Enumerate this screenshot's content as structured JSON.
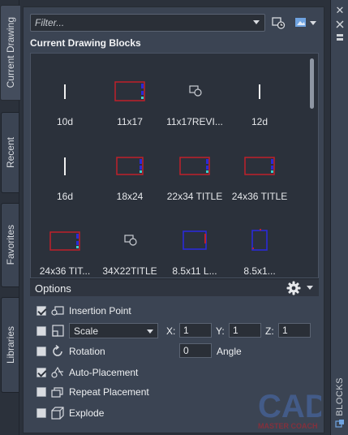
{
  "left_tabs": [
    {
      "label": "Current Drawing",
      "active": true
    },
    {
      "label": "Recent",
      "active": false
    },
    {
      "label": "Favorites",
      "active": false
    },
    {
      "label": "Libraries",
      "active": false
    }
  ],
  "right_strip": {
    "panel_label": "BLOCKS"
  },
  "toolbar": {
    "filter_placeholder": "Filter..."
  },
  "section_title": "Current Drawing Blocks",
  "blocks": [
    {
      "name": "10d",
      "icon": "vertical-line-icon"
    },
    {
      "name": "11x17",
      "icon": "titleblock-red-icon"
    },
    {
      "name": "11x17REVI...",
      "icon": "small-block-icon"
    },
    {
      "name": "12d",
      "icon": "vertical-line-icon"
    },
    {
      "name": "16d",
      "icon": "vertical-line-icon"
    },
    {
      "name": "18x24",
      "icon": "titleblock-red-icon"
    },
    {
      "name": "22x34 TITLE",
      "icon": "titleblock-red-icon"
    },
    {
      "name": "24x36 TITLE",
      "icon": "titleblock-red-icon"
    },
    {
      "name": "24x36 TIT...",
      "icon": "titleblock-red-icon"
    },
    {
      "name": "34X22TITLE",
      "icon": "small-block-icon"
    },
    {
      "name": "8.5x11 L...",
      "icon": "titleblock-blue-icon"
    },
    {
      "name": "8.5x1...",
      "icon": "titleblock-blue-portrait-icon"
    }
  ],
  "options": {
    "title": "Options",
    "insertion_point": {
      "label": "Insertion Point",
      "checked": true
    },
    "scale": {
      "checked": false,
      "mode": "Scale",
      "x_label": "X:",
      "x": "1",
      "y_label": "Y:",
      "y": "1",
      "z_label": "Z:",
      "z": "1"
    },
    "rotation": {
      "label": "Rotation",
      "checked": false,
      "angle_value": "0",
      "angle_label": "Angle"
    },
    "auto_placement": {
      "label": "Auto-Placement",
      "checked": true
    },
    "repeat_placement": {
      "label": "Repeat Placement",
      "checked": false
    },
    "explode": {
      "label": "Explode",
      "checked": false
    }
  },
  "watermark": {
    "text": "CAD",
    "subtext": "MASTER COACH"
  },
  "colors": {
    "panel": "#3b4453",
    "background": "#2b313b",
    "titleblock_red": "#c0202a",
    "titleblock_blue": "#2a2ad8"
  }
}
